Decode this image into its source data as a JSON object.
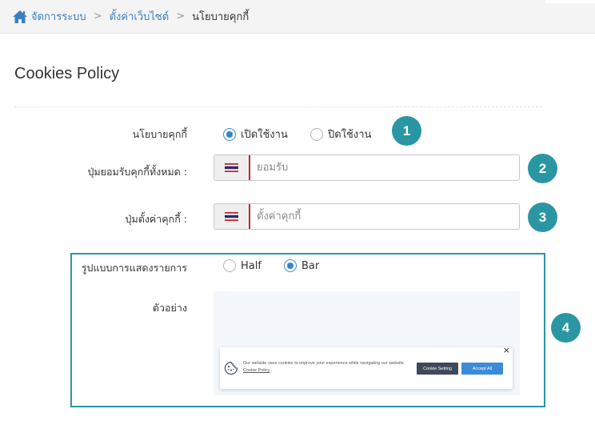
{
  "breadcrumb": {
    "items": [
      "จัดการระบบ",
      "ตั้งค่าเว็บไซต์"
    ],
    "current": "นโยบายคุกกี้",
    "separator": ">"
  },
  "page": {
    "title": "Cookies Policy"
  },
  "form": {
    "policy": {
      "label": "นโยบายคุกกี้",
      "options": [
        {
          "label": "เปิดใช้งาน",
          "checked": true
        },
        {
          "label": "ปิดใช้งาน",
          "checked": false
        }
      ]
    },
    "accept_all": {
      "label": "ปุ่มยอมรับคุกกี้ทั้งหมด :",
      "placeholder": "ยอมรับ",
      "value": ""
    },
    "settings_btn": {
      "label": "ปุ่มตั้งค่าคุกกี้ :",
      "placeholder": "ตั้งค่าคุกกี้",
      "value": ""
    },
    "display": {
      "label": "รูปแบบการแสดงรายการ",
      "options": [
        {
          "label": "Half",
          "checked": false
        },
        {
          "label": "Bar",
          "checked": true
        }
      ]
    },
    "preview_label": "ตัวอย่าง"
  },
  "preview_bar": {
    "message": "Our website uses cookies to improve your experience while navigating our website.",
    "link": "Cookie Policy",
    "setting_button": "Cookie Setting",
    "accept_button": "Accept All",
    "close": "×"
  },
  "badges": [
    "1",
    "2",
    "3",
    "4"
  ],
  "colors": {
    "accent": "#2a96a3",
    "link": "#3a7fc0",
    "radio": "#2f86cf",
    "flag_border": "#c0272d"
  },
  "icons": {
    "home": "home-icon",
    "flag": "thai-flag-icon",
    "cookie": "cookie-icon"
  }
}
